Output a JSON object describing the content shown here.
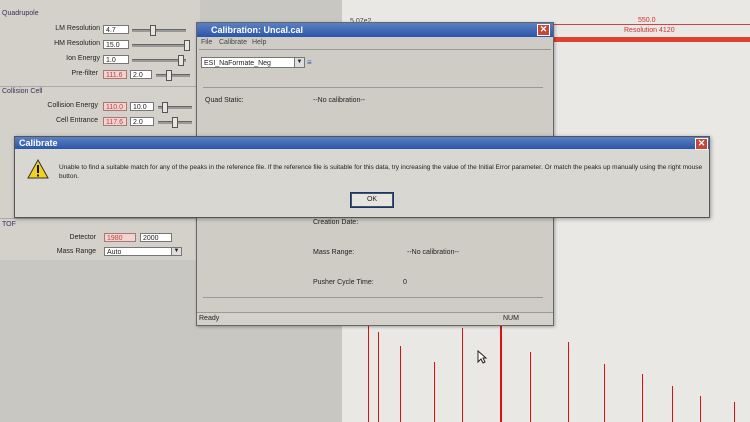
{
  "tune": {
    "quadrupole_header": "Quadrupole",
    "lm_resolution": {
      "label": "LM Resolution",
      "value": "4.7"
    },
    "hm_resolution": {
      "label": "HM Resolution",
      "value": "15.0"
    },
    "ion_energy": {
      "label": "Ion Energy",
      "value": "1.0"
    },
    "prefilter": {
      "label": "Pre-filter",
      "readback": "111.6",
      "value": "2.0"
    },
    "collision_header": "Collision Cell",
    "collision_energy": {
      "label": "Collision Energy",
      "readback": "110.0",
      "value": "10.0"
    },
    "cell_entrance": {
      "label": "Cell Entrance",
      "readback": "117.6",
      "value": "2.0"
    },
    "tof_header": "TOF",
    "detector": {
      "label": "Detector",
      "readback": "1980",
      "value": "2000"
    },
    "mass_range": {
      "label": "Mass Range",
      "value": "Auto"
    }
  },
  "spectrum": {
    "intensity_label": "5.07e2",
    "mass_label": "550.0",
    "resolution_label": "Resolution 4120"
  },
  "calibration_window": {
    "title": "Calibration: Uncal.cal",
    "menu": [
      "File",
      "Calibrate",
      "Help"
    ],
    "reference_select": "ESI_NaFormate_Neg",
    "quad_static_label": "Quad Static:",
    "quad_static_value": "--No calibration--",
    "creation_date_label": "Creation Date:",
    "mass_range_label": "Mass Range:",
    "mass_range_value": "--No calibration--",
    "pusher_label": "Pusher Cycle Time:",
    "pusher_value": "0",
    "status_ready": "Ready",
    "status_num": "NUM"
  },
  "dialog": {
    "title": "Calibrate",
    "message_line1": "Unable to find a suitable match for any of the peaks in the reference file.  If the reference file is suitable for this data, try increasing the value of the Initial Error parameter.  Or match the peaks up manually using the right mouse",
    "message_line2": "button.",
    "ok_label": "OK"
  },
  "colors": {
    "accent_red": "#d11010",
    "titlebar_blue": "#2b56a8"
  }
}
